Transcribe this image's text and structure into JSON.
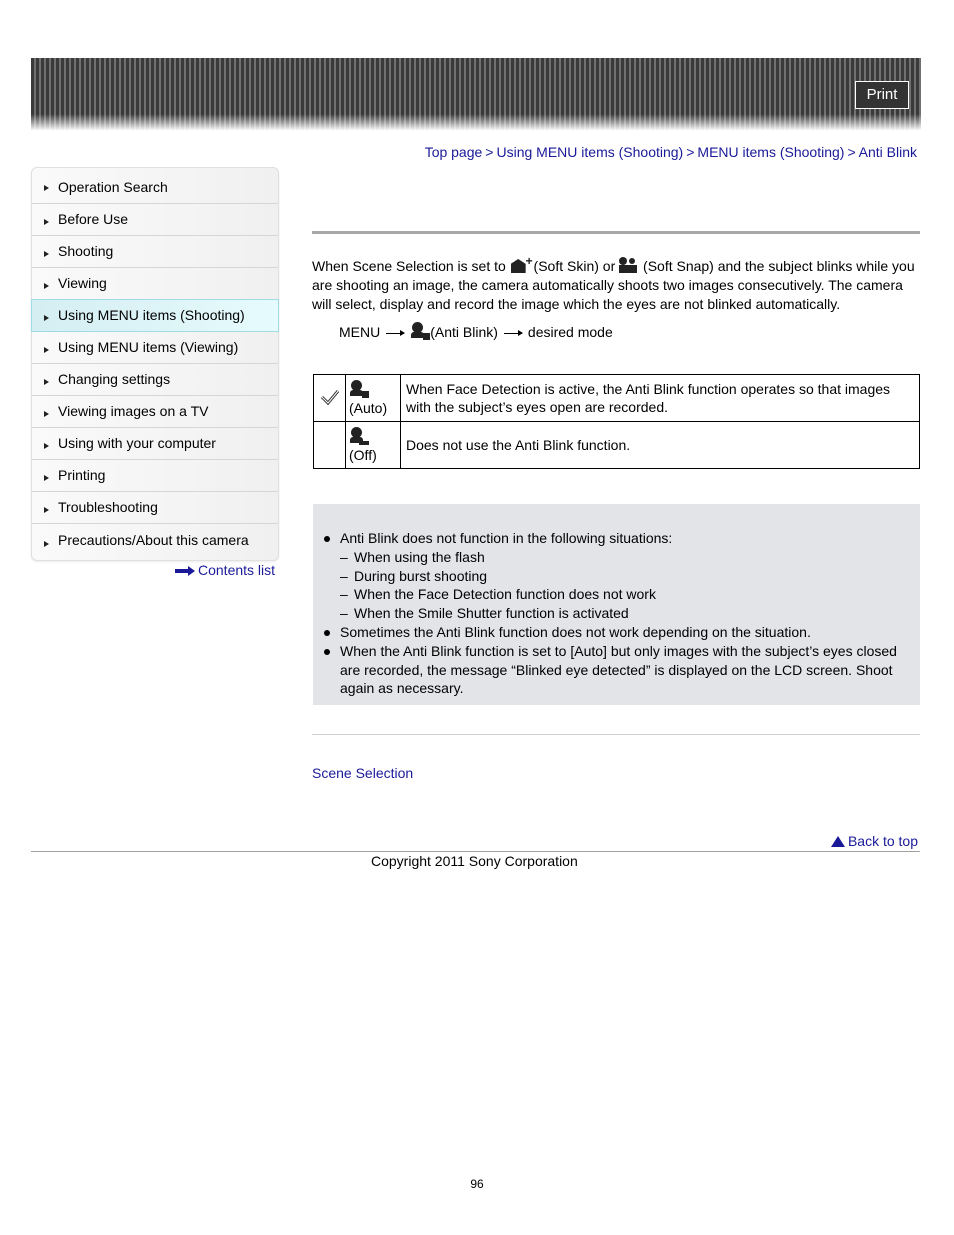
{
  "header": {
    "print_label": "Print"
  },
  "breadcrumb": [
    {
      "label": "Top page"
    },
    {
      "label": "Using MENU items (Shooting)"
    },
    {
      "label": "MENU items (Shooting)"
    },
    {
      "label": "Anti Blink"
    }
  ],
  "breadcrumb_separator": ">",
  "sidebar": {
    "items": [
      {
        "label": "Operation Search"
      },
      {
        "label": "Before Use"
      },
      {
        "label": "Shooting"
      },
      {
        "label": "Viewing"
      },
      {
        "label": "Using MENU items (Shooting)",
        "active": true
      },
      {
        "label": "Using MENU items (Viewing)"
      },
      {
        "label": "Changing settings"
      },
      {
        "label": "Viewing images on a TV"
      },
      {
        "label": "Using with your computer"
      },
      {
        "label": "Printing"
      },
      {
        "label": "Troubleshooting"
      },
      {
        "label": "Precautions/About this camera"
      }
    ],
    "contents_link": "Contents list"
  },
  "intro": {
    "part1": "When Scene Selection is set to ",
    "soft_skin": " (Soft Skin) or ",
    "soft_snap": " (Soft Snap) and the subject blinks while you are shooting an image, the camera automatically shoots two images consecutively. The camera will select, display and record the image which the eyes are not blinked automatically."
  },
  "menu_path": {
    "menu": "MENU",
    "anti_blink": "(Anti Blink)",
    "desired": "desired mode"
  },
  "modes": [
    {
      "default": true,
      "icon": "anti-blink-auto-icon",
      "label": "(Auto)",
      "description": "When Face Detection is active, the Anti Blink function operates so that images with the subject’s eyes open are recorded."
    },
    {
      "default": false,
      "icon": "anti-blink-off-icon",
      "label": "(Off)",
      "description": "Does not use the Anti Blink function."
    }
  ],
  "notes": {
    "items": [
      {
        "type": "bullet",
        "text": "Anti Blink does not function in the following situations:"
      },
      {
        "type": "sub",
        "text": "When using the flash"
      },
      {
        "type": "sub",
        "text": "During burst shooting"
      },
      {
        "type": "sub",
        "text": "When the Face Detection function does not work"
      },
      {
        "type": "sub",
        "text": "When the Smile Shutter function is activated"
      },
      {
        "type": "bullet",
        "text": "Sometimes the Anti Blink function does not work depending on the situation."
      },
      {
        "type": "bullet",
        "text": "When the Anti Blink function is set to [Auto] but only images with the subject’s eyes closed are recorded, the message “Blinked eye detected” is displayed on the LCD screen. Shoot again as necessary."
      }
    ]
  },
  "related": {
    "link": "Scene Selection"
  },
  "footer": {
    "back_to_top": "Back to top",
    "copyright": "Copyright 2011 Sony Corporation",
    "page_number": "96"
  },
  "colors": {
    "link": "#1a1a99",
    "active_nav": "#e6fbfd",
    "notes_bg": "#e2e4e8"
  }
}
